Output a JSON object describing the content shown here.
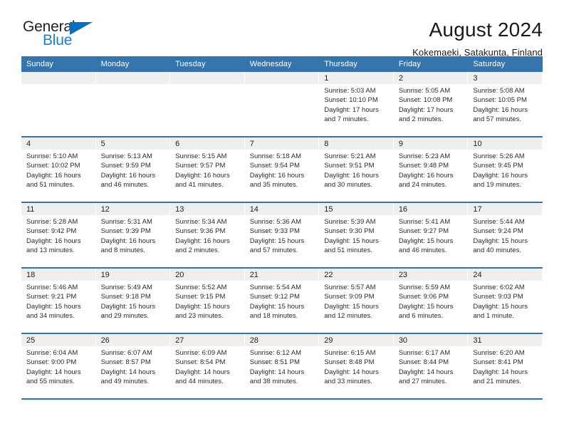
{
  "brand": {
    "name_top": "General",
    "name_bottom": "Blue",
    "accent_color": "#1f7dc4",
    "header_color": "#3675ac"
  },
  "header": {
    "title": "August 2024",
    "subtitle": "Kokemaeki, Satakunta, Finland"
  },
  "weekdays": [
    "Sunday",
    "Monday",
    "Tuesday",
    "Wednesday",
    "Thursday",
    "Friday",
    "Saturday"
  ],
  "weeks": [
    [
      {
        "day": "",
        "empty": true
      },
      {
        "day": "",
        "empty": true
      },
      {
        "day": "",
        "empty": true
      },
      {
        "day": "",
        "empty": true
      },
      {
        "day": "1",
        "sunrise": "Sunrise: 5:03 AM",
        "sunset": "Sunset: 10:10 PM",
        "daylight1": "Daylight: 17 hours",
        "daylight2": "and 7 minutes."
      },
      {
        "day": "2",
        "sunrise": "Sunrise: 5:05 AM",
        "sunset": "Sunset: 10:08 PM",
        "daylight1": "Daylight: 17 hours",
        "daylight2": "and 2 minutes."
      },
      {
        "day": "3",
        "sunrise": "Sunrise: 5:08 AM",
        "sunset": "Sunset: 10:05 PM",
        "daylight1": "Daylight: 16 hours",
        "daylight2": "and 57 minutes."
      }
    ],
    [
      {
        "day": "4",
        "sunrise": "Sunrise: 5:10 AM",
        "sunset": "Sunset: 10:02 PM",
        "daylight1": "Daylight: 16 hours",
        "daylight2": "and 51 minutes."
      },
      {
        "day": "5",
        "sunrise": "Sunrise: 5:13 AM",
        "sunset": "Sunset: 9:59 PM",
        "daylight1": "Daylight: 16 hours",
        "daylight2": "and 46 minutes."
      },
      {
        "day": "6",
        "sunrise": "Sunrise: 5:15 AM",
        "sunset": "Sunset: 9:57 PM",
        "daylight1": "Daylight: 16 hours",
        "daylight2": "and 41 minutes."
      },
      {
        "day": "7",
        "sunrise": "Sunrise: 5:18 AM",
        "sunset": "Sunset: 9:54 PM",
        "daylight1": "Daylight: 16 hours",
        "daylight2": "and 35 minutes."
      },
      {
        "day": "8",
        "sunrise": "Sunrise: 5:21 AM",
        "sunset": "Sunset: 9:51 PM",
        "daylight1": "Daylight: 16 hours",
        "daylight2": "and 30 minutes."
      },
      {
        "day": "9",
        "sunrise": "Sunrise: 5:23 AM",
        "sunset": "Sunset: 9:48 PM",
        "daylight1": "Daylight: 16 hours",
        "daylight2": "and 24 minutes."
      },
      {
        "day": "10",
        "sunrise": "Sunrise: 5:26 AM",
        "sunset": "Sunset: 9:45 PM",
        "daylight1": "Daylight: 16 hours",
        "daylight2": "and 19 minutes."
      }
    ],
    [
      {
        "day": "11",
        "sunrise": "Sunrise: 5:28 AM",
        "sunset": "Sunset: 9:42 PM",
        "daylight1": "Daylight: 16 hours",
        "daylight2": "and 13 minutes."
      },
      {
        "day": "12",
        "sunrise": "Sunrise: 5:31 AM",
        "sunset": "Sunset: 9:39 PM",
        "daylight1": "Daylight: 16 hours",
        "daylight2": "and 8 minutes."
      },
      {
        "day": "13",
        "sunrise": "Sunrise: 5:34 AM",
        "sunset": "Sunset: 9:36 PM",
        "daylight1": "Daylight: 16 hours",
        "daylight2": "and 2 minutes."
      },
      {
        "day": "14",
        "sunrise": "Sunrise: 5:36 AM",
        "sunset": "Sunset: 9:33 PM",
        "daylight1": "Daylight: 15 hours",
        "daylight2": "and 57 minutes."
      },
      {
        "day": "15",
        "sunrise": "Sunrise: 5:39 AM",
        "sunset": "Sunset: 9:30 PM",
        "daylight1": "Daylight: 15 hours",
        "daylight2": "and 51 minutes."
      },
      {
        "day": "16",
        "sunrise": "Sunrise: 5:41 AM",
        "sunset": "Sunset: 9:27 PM",
        "daylight1": "Daylight: 15 hours",
        "daylight2": "and 46 minutes."
      },
      {
        "day": "17",
        "sunrise": "Sunrise: 5:44 AM",
        "sunset": "Sunset: 9:24 PM",
        "daylight1": "Daylight: 15 hours",
        "daylight2": "and 40 minutes."
      }
    ],
    [
      {
        "day": "18",
        "sunrise": "Sunrise: 5:46 AM",
        "sunset": "Sunset: 9:21 PM",
        "daylight1": "Daylight: 15 hours",
        "daylight2": "and 34 minutes."
      },
      {
        "day": "19",
        "sunrise": "Sunrise: 5:49 AM",
        "sunset": "Sunset: 9:18 PM",
        "daylight1": "Daylight: 15 hours",
        "daylight2": "and 29 minutes."
      },
      {
        "day": "20",
        "sunrise": "Sunrise: 5:52 AM",
        "sunset": "Sunset: 9:15 PM",
        "daylight1": "Daylight: 15 hours",
        "daylight2": "and 23 minutes."
      },
      {
        "day": "21",
        "sunrise": "Sunrise: 5:54 AM",
        "sunset": "Sunset: 9:12 PM",
        "daylight1": "Daylight: 15 hours",
        "daylight2": "and 18 minutes."
      },
      {
        "day": "22",
        "sunrise": "Sunrise: 5:57 AM",
        "sunset": "Sunset: 9:09 PM",
        "daylight1": "Daylight: 15 hours",
        "daylight2": "and 12 minutes."
      },
      {
        "day": "23",
        "sunrise": "Sunrise: 5:59 AM",
        "sunset": "Sunset: 9:06 PM",
        "daylight1": "Daylight: 15 hours",
        "daylight2": "and 6 minutes."
      },
      {
        "day": "24",
        "sunrise": "Sunrise: 6:02 AM",
        "sunset": "Sunset: 9:03 PM",
        "daylight1": "Daylight: 15 hours",
        "daylight2": "and 1 minute."
      }
    ],
    [
      {
        "day": "25",
        "sunrise": "Sunrise: 6:04 AM",
        "sunset": "Sunset: 9:00 PM",
        "daylight1": "Daylight: 14 hours",
        "daylight2": "and 55 minutes."
      },
      {
        "day": "26",
        "sunrise": "Sunrise: 6:07 AM",
        "sunset": "Sunset: 8:57 PM",
        "daylight1": "Daylight: 14 hours",
        "daylight2": "and 49 minutes."
      },
      {
        "day": "27",
        "sunrise": "Sunrise: 6:09 AM",
        "sunset": "Sunset: 8:54 PM",
        "daylight1": "Daylight: 14 hours",
        "daylight2": "and 44 minutes."
      },
      {
        "day": "28",
        "sunrise": "Sunrise: 6:12 AM",
        "sunset": "Sunset: 8:51 PM",
        "daylight1": "Daylight: 14 hours",
        "daylight2": "and 38 minutes."
      },
      {
        "day": "29",
        "sunrise": "Sunrise: 6:15 AM",
        "sunset": "Sunset: 8:48 PM",
        "daylight1": "Daylight: 14 hours",
        "daylight2": "and 33 minutes."
      },
      {
        "day": "30",
        "sunrise": "Sunrise: 6:17 AM",
        "sunset": "Sunset: 8:44 PM",
        "daylight1": "Daylight: 14 hours",
        "daylight2": "and 27 minutes."
      },
      {
        "day": "31",
        "sunrise": "Sunrise: 6:20 AM",
        "sunset": "Sunset: 8:41 PM",
        "daylight1": "Daylight: 14 hours",
        "daylight2": "and 21 minutes."
      }
    ]
  ]
}
